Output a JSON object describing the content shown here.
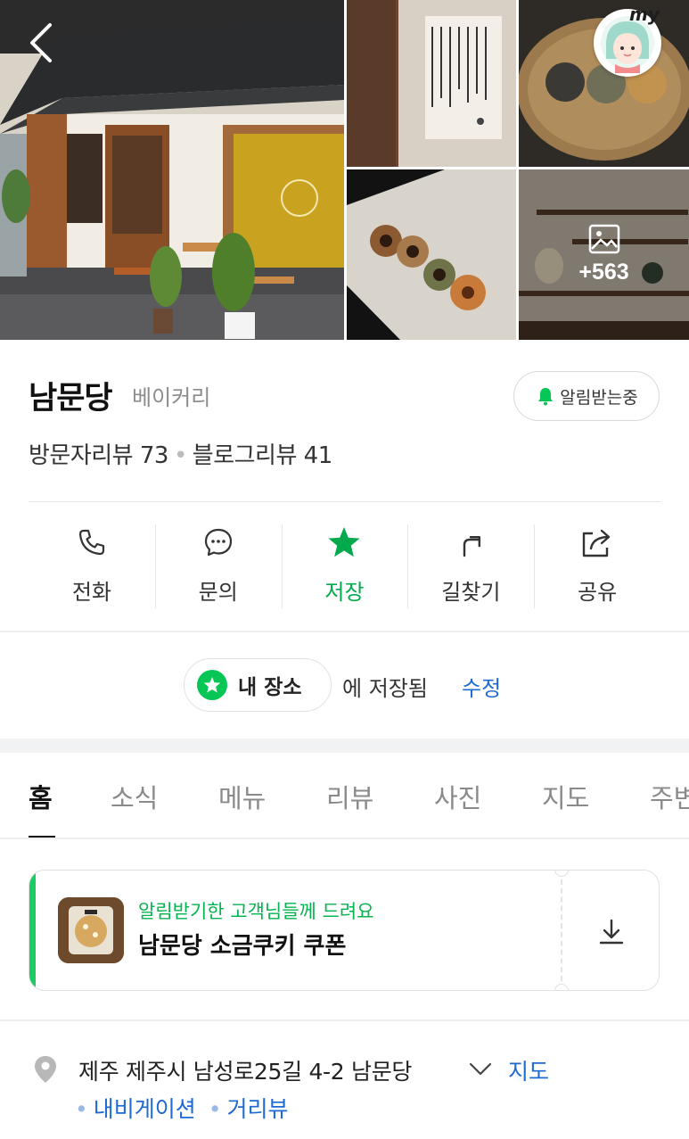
{
  "gallery": {
    "more_count": "+563",
    "my_label": "my"
  },
  "place": {
    "name": "남문당",
    "category": "베이커리",
    "notify_label": "알림받는중",
    "visitor_reviews": "방문자리뷰 73",
    "blog_reviews": "블로그리뷰 41"
  },
  "actions": [
    {
      "label": "전화",
      "icon": "phone-icon"
    },
    {
      "label": "문의",
      "icon": "chat-bubble-icon"
    },
    {
      "label": "저장",
      "icon": "star-icon"
    },
    {
      "label": "길찾기",
      "icon": "directions-arrow-icon"
    },
    {
      "label": "공유",
      "icon": "share-icon"
    }
  ],
  "saved": {
    "chip_label": "내 장소",
    "suffix": "에 저장됨",
    "edit_label": "수정"
  },
  "tabs": [
    "홈",
    "소식",
    "메뉴",
    "리뷰",
    "사진",
    "지도",
    "주변"
  ],
  "coupon": {
    "subtitle": "알림받기한 고객님들께 드려요",
    "title": "남문당 소금쿠키 쿠폰"
  },
  "address": {
    "text": "제주 제주시 남성로25길 4-2 남문당",
    "map_label": "지도",
    "navigation_label": "내비게이션",
    "street_view_label": "거리뷰"
  },
  "colors": {
    "accent_green": "#03a94d",
    "link_blue": "#1e6ad3"
  }
}
